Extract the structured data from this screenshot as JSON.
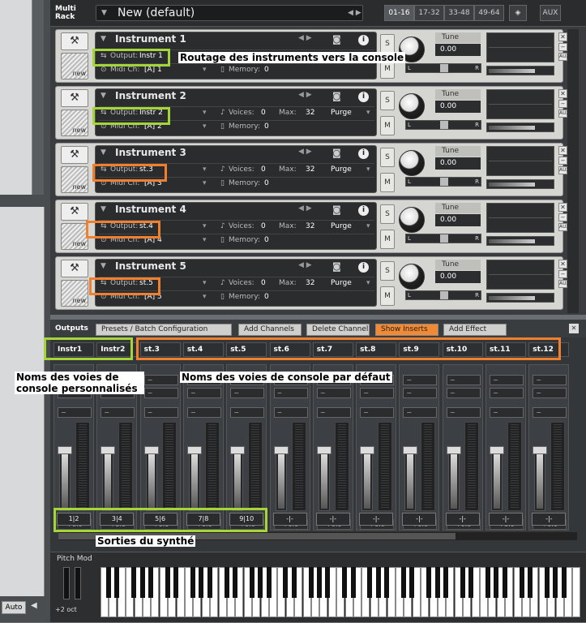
{
  "rack": {
    "title": "Multi Rack",
    "preset": "New (default)",
    "pages": [
      "01-16",
      "17-32",
      "33-48",
      "49-64"
    ],
    "aux": "AUX"
  },
  "instruments": [
    {
      "name": "Instrument 1",
      "output": "Instr 1",
      "midi": "[A] 1",
      "memory": "0",
      "tune": "Tune",
      "tune_val": "0.00"
    },
    {
      "name": "Instrument 2",
      "output": "Instr 2",
      "midi": "[A] 2",
      "voices": "0",
      "max": "32",
      "memory": "0",
      "purge": "Purge",
      "tune": "Tune",
      "tune_val": "0.00"
    },
    {
      "name": "Instrument 3",
      "output": "st.3",
      "midi": "[A] 3",
      "voices": "0",
      "max": "32",
      "memory": "0",
      "purge": "Purge",
      "tune": "Tune",
      "tune_val": "0.00"
    },
    {
      "name": "Instrument 4",
      "output": "st.4",
      "midi": "[A] 4",
      "voices": "0",
      "max": "32",
      "memory": "0",
      "purge": "Purge",
      "tune": "Tune",
      "tune_val": "0.00"
    },
    {
      "name": "Instrument 5",
      "output": "st.5",
      "midi": "[A] 5",
      "voices": "0",
      "max": "32",
      "memory": "0",
      "purge": "Purge",
      "tune": "Tune",
      "tune_val": "0.00"
    }
  ],
  "labels": {
    "output": "Output:",
    "midi": "Midi Ch:",
    "memory": "Memory:",
    "voices": "Voices:",
    "max": "Max:",
    "s": "S",
    "m": "M",
    "new": "new",
    "aux": "AUX"
  },
  "outputs": {
    "title": "Outputs",
    "buttons": [
      "Presets / Batch Configuration",
      "Add Channels",
      "Delete Channel",
      "Show Inserts",
      "Add Effect"
    ],
    "channels": [
      "Instr1",
      "Instr2",
      "st.3",
      "st.4",
      "st.5",
      "st.6",
      "st.7",
      "st.8",
      "st.9",
      "st.10",
      "st.11",
      "st.12"
    ],
    "routes": [
      "1|2",
      "3|4",
      "5|6",
      "7|8",
      "9|10",
      "-|-",
      "-|-",
      "-|-",
      "-|-",
      "-|-",
      "-|-",
      "-|-"
    ],
    "db": "+0.0"
  },
  "annotations": {
    "a1": "Routage des instruments vers la console",
    "a2": "Noms des voies de console personnalisés",
    "a3": "Noms des voies de console par défaut",
    "a4": "Sorties du synthé"
  },
  "keyboard": {
    "pitch": "Pitch Mod",
    "oct": "+2 oct"
  },
  "left": {
    "auto": "Auto"
  },
  "colors": {
    "green": "#a4d63a",
    "orange": "#f07f2e",
    "accent": "#f28a33"
  }
}
